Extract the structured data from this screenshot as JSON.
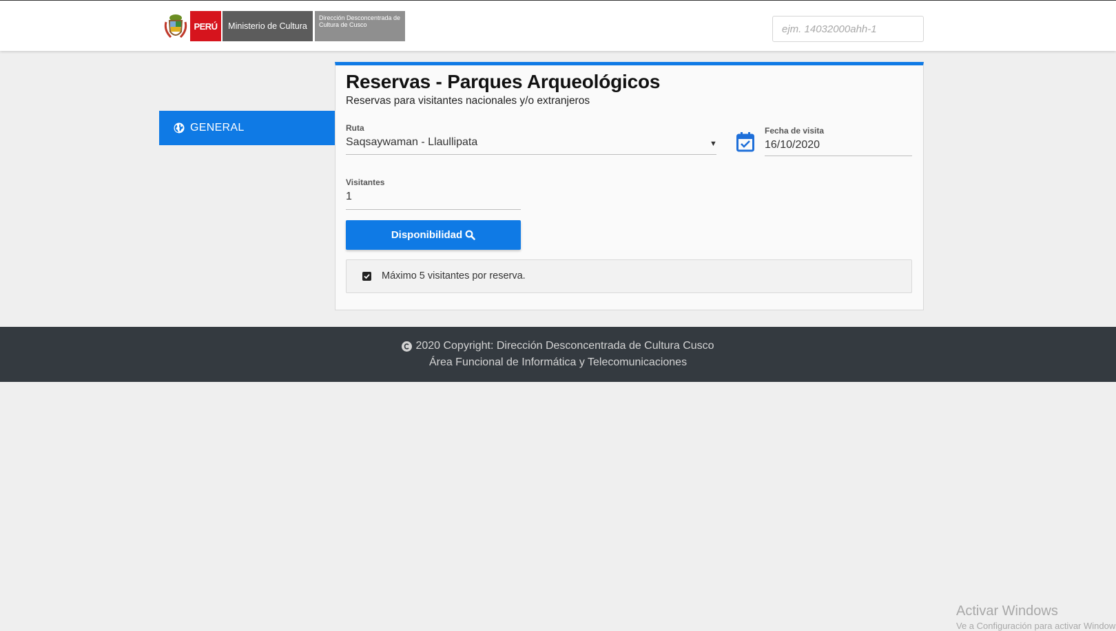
{
  "header": {
    "logo": {
      "country": "PERÚ",
      "ministry": "Ministerio de Cultura",
      "directorate": "Dirección Desconcentrada de Cultura de Cusco"
    },
    "search": {
      "placeholder": "ejm. 14032000ahh-1",
      "value": ""
    }
  },
  "sidebar": {
    "items": [
      {
        "label": "GENERAL",
        "icon": "globe-icon",
        "active": true
      }
    ]
  },
  "main": {
    "title": "Reservas - Parques Arqueológicos",
    "subtitle": "Reservas para visitantes nacionales y/o extranjeros",
    "ruta": {
      "label": "Ruta",
      "value": "Saqsaywaman - Llaullipata"
    },
    "fecha": {
      "label": "Fecha de visita",
      "value": "16/10/2020",
      "icon": "calendar-check-icon"
    },
    "visitantes": {
      "label": "Visitantes",
      "value": "1"
    },
    "button": {
      "label": "Disponibilidad",
      "icon": "search-icon"
    },
    "note": {
      "text": "Máximo 5 visitantes por reserva.",
      "checked": true
    }
  },
  "footer": {
    "line1": "2020 Copyright: Dirección Desconcentrada de Cultura Cusco",
    "line2": "Área Funcional de Informática y Telecomunicaciones"
  },
  "os_watermark": {
    "title": "Activar Windows",
    "subtitle": "Ve a Configuración para activar Windows."
  },
  "colors": {
    "accent": "#0f7ae5",
    "footer_bg": "#343a40",
    "peru_red": "#d6141d"
  }
}
